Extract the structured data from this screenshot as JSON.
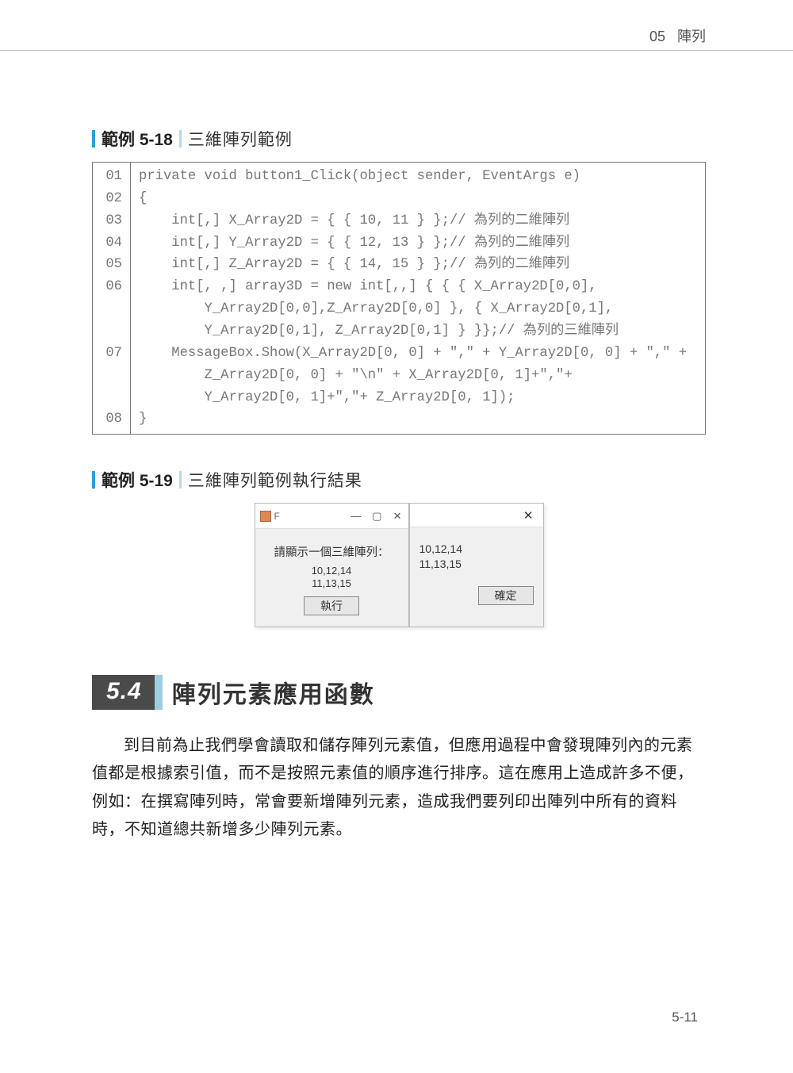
{
  "header": {
    "chapter_num": "05",
    "chapter_name": "陣列"
  },
  "example1": {
    "label": "範例 5-18",
    "title": "三維陣列範例"
  },
  "code": {
    "lines": [
      {
        "n": "01",
        "t": "private void button1_Click(object sender, EventArgs e)"
      },
      {
        "n": "02",
        "t": "{"
      },
      {
        "n": "03",
        "t": "    int[,] X_Array2D = { { 10, 11 } };// 為列的二維陣列"
      },
      {
        "n": "04",
        "t": "    int[,] Y_Array2D = { { 12, 13 } };// 為列的二維陣列"
      },
      {
        "n": "05",
        "t": "    int[,] Z_Array2D = { { 14, 15 } };// 為列的二維陣列"
      },
      {
        "n": "06",
        "t": "    int[, ,] array3D = new int[,,] { { { X_Array2D[0,0],"
      },
      {
        "n": "",
        "t": "        Y_Array2D[0,0],Z_Array2D[0,0] }, { X_Array2D[0,1],"
      },
      {
        "n": "",
        "t": "        Y_Array2D[0,1], Z_Array2D[0,1] } }};// 為列的三維陣列"
      },
      {
        "n": "07",
        "t": "    MessageBox.Show(X_Array2D[0, 0] + \",\" + Y_Array2D[0, 0] + \",\" +"
      },
      {
        "n": "",
        "t": "        Z_Array2D[0, 0] + \"\\n\" + X_Array2D[0, 1]+\",\"+"
      },
      {
        "n": "",
        "t": "        Y_Array2D[0, 1]+\",\"+ Z_Array2D[0, 1]);"
      },
      {
        "n": "08",
        "t": "}"
      }
    ]
  },
  "example2": {
    "label": "範例 5-19",
    "title": "三維陣列範例執行結果"
  },
  "win_left": {
    "title": "F",
    "minimize": "—",
    "maximize": "▢",
    "close": "✕",
    "prompt": "請顯示一個三維陣列：",
    "line1": "10,12,14",
    "line2": "11,13,15",
    "btn": "執行"
  },
  "win_right": {
    "close": "✕",
    "line1": "10,12,14",
    "line2": "11,13,15",
    "btn": "確定"
  },
  "section": {
    "num": "5.4",
    "title": "陣列元素應用函數"
  },
  "paragraph": "到目前為止我們學會讀取和儲存陣列元素值，但應用過程中會發現陣列內的元素值都是根據索引值，而不是按照元素值的順序進行排序。這在應用上造成許多不便，例如：在撰寫陣列時，常會要新增陣列元素，造成我們要列印出陣列中所有的資料時，不知道總共新增多少陣列元素。",
  "page_num": "5-11"
}
